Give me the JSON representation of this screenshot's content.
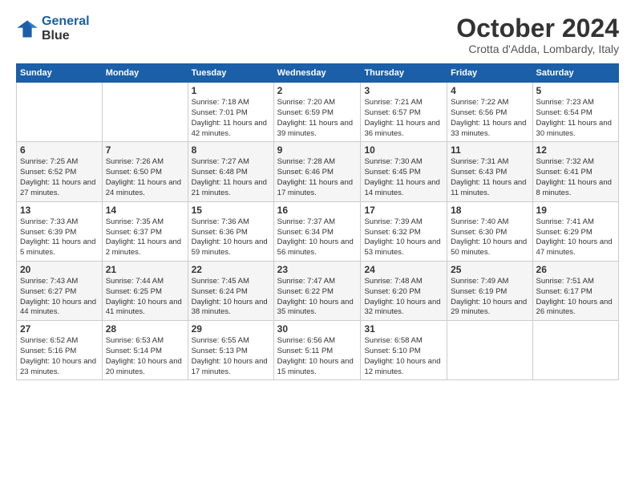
{
  "logo": {
    "line1": "General",
    "line2": "Blue"
  },
  "title": "October 2024",
  "location": "Crotta d'Adda, Lombardy, Italy",
  "days_of_week": [
    "Sunday",
    "Monday",
    "Tuesday",
    "Wednesday",
    "Thursday",
    "Friday",
    "Saturday"
  ],
  "weeks": [
    [
      null,
      null,
      {
        "day": "1",
        "sunrise": "7:18 AM",
        "sunset": "7:01 PM",
        "daylight": "11 hours and 42 minutes."
      },
      {
        "day": "2",
        "sunrise": "7:20 AM",
        "sunset": "6:59 PM",
        "daylight": "11 hours and 39 minutes."
      },
      {
        "day": "3",
        "sunrise": "7:21 AM",
        "sunset": "6:57 PM",
        "daylight": "11 hours and 36 minutes."
      },
      {
        "day": "4",
        "sunrise": "7:22 AM",
        "sunset": "6:56 PM",
        "daylight": "11 hours and 33 minutes."
      },
      {
        "day": "5",
        "sunrise": "7:23 AM",
        "sunset": "6:54 PM",
        "daylight": "11 hours and 30 minutes."
      }
    ],
    [
      {
        "day": "6",
        "sunrise": "7:25 AM",
        "sunset": "6:52 PM",
        "daylight": "11 hours and 27 minutes."
      },
      {
        "day": "7",
        "sunrise": "7:26 AM",
        "sunset": "6:50 PM",
        "daylight": "11 hours and 24 minutes."
      },
      {
        "day": "8",
        "sunrise": "7:27 AM",
        "sunset": "6:48 PM",
        "daylight": "11 hours and 21 minutes."
      },
      {
        "day": "9",
        "sunrise": "7:28 AM",
        "sunset": "6:46 PM",
        "daylight": "11 hours and 17 minutes."
      },
      {
        "day": "10",
        "sunrise": "7:30 AM",
        "sunset": "6:45 PM",
        "daylight": "11 hours and 14 minutes."
      },
      {
        "day": "11",
        "sunrise": "7:31 AM",
        "sunset": "6:43 PM",
        "daylight": "11 hours and 11 minutes."
      },
      {
        "day": "12",
        "sunrise": "7:32 AM",
        "sunset": "6:41 PM",
        "daylight": "11 hours and 8 minutes."
      }
    ],
    [
      {
        "day": "13",
        "sunrise": "7:33 AM",
        "sunset": "6:39 PM",
        "daylight": "11 hours and 5 minutes."
      },
      {
        "day": "14",
        "sunrise": "7:35 AM",
        "sunset": "6:37 PM",
        "daylight": "11 hours and 2 minutes."
      },
      {
        "day": "15",
        "sunrise": "7:36 AM",
        "sunset": "6:36 PM",
        "daylight": "10 hours and 59 minutes."
      },
      {
        "day": "16",
        "sunrise": "7:37 AM",
        "sunset": "6:34 PM",
        "daylight": "10 hours and 56 minutes."
      },
      {
        "day": "17",
        "sunrise": "7:39 AM",
        "sunset": "6:32 PM",
        "daylight": "10 hours and 53 minutes."
      },
      {
        "day": "18",
        "sunrise": "7:40 AM",
        "sunset": "6:30 PM",
        "daylight": "10 hours and 50 minutes."
      },
      {
        "day": "19",
        "sunrise": "7:41 AM",
        "sunset": "6:29 PM",
        "daylight": "10 hours and 47 minutes."
      }
    ],
    [
      {
        "day": "20",
        "sunrise": "7:43 AM",
        "sunset": "6:27 PM",
        "daylight": "10 hours and 44 minutes."
      },
      {
        "day": "21",
        "sunrise": "7:44 AM",
        "sunset": "6:25 PM",
        "daylight": "10 hours and 41 minutes."
      },
      {
        "day": "22",
        "sunrise": "7:45 AM",
        "sunset": "6:24 PM",
        "daylight": "10 hours and 38 minutes."
      },
      {
        "day": "23",
        "sunrise": "7:47 AM",
        "sunset": "6:22 PM",
        "daylight": "10 hours and 35 minutes."
      },
      {
        "day": "24",
        "sunrise": "7:48 AM",
        "sunset": "6:20 PM",
        "daylight": "10 hours and 32 minutes."
      },
      {
        "day": "25",
        "sunrise": "7:49 AM",
        "sunset": "6:19 PM",
        "daylight": "10 hours and 29 minutes."
      },
      {
        "day": "26",
        "sunrise": "7:51 AM",
        "sunset": "6:17 PM",
        "daylight": "10 hours and 26 minutes."
      }
    ],
    [
      {
        "day": "27",
        "sunrise": "6:52 AM",
        "sunset": "5:16 PM",
        "daylight": "10 hours and 23 minutes."
      },
      {
        "day": "28",
        "sunrise": "6:53 AM",
        "sunset": "5:14 PM",
        "daylight": "10 hours and 20 minutes."
      },
      {
        "day": "29",
        "sunrise": "6:55 AM",
        "sunset": "5:13 PM",
        "daylight": "10 hours and 17 minutes."
      },
      {
        "day": "30",
        "sunrise": "6:56 AM",
        "sunset": "5:11 PM",
        "daylight": "10 hours and 15 minutes."
      },
      {
        "day": "31",
        "sunrise": "6:58 AM",
        "sunset": "5:10 PM",
        "daylight": "10 hours and 12 minutes."
      },
      null,
      null
    ]
  ]
}
